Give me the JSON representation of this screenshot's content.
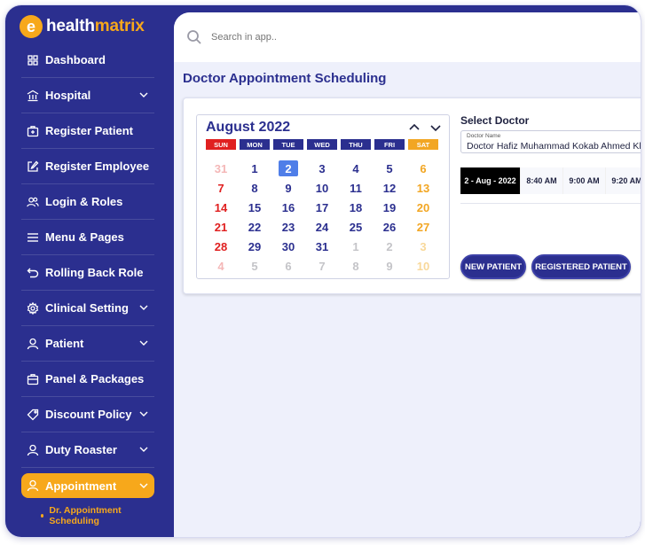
{
  "app": {
    "logo_letter": "e",
    "name_part1": "health",
    "name_part2": "matrix"
  },
  "colors": {
    "brand": "#2b2f8f",
    "accent": "#f7a81b",
    "selected_day": "#4f7ee8",
    "sunday": "#e02020",
    "saturday": "#f2a623"
  },
  "search": {
    "placeholder": "Search in app.."
  },
  "sidebar": {
    "items": [
      {
        "label": "Dashboard",
        "icon": "grid-icon",
        "expandable": false
      },
      {
        "label": "Hospital",
        "icon": "hospital-icon",
        "expandable": true
      },
      {
        "label": "Register Patient",
        "icon": "medical-bag-icon",
        "expandable": false
      },
      {
        "label": "Register Employee",
        "icon": "edit-icon",
        "expandable": false
      },
      {
        "label": "Login & Roles",
        "icon": "users-icon",
        "expandable": false
      },
      {
        "label": "Menu & Pages",
        "icon": "menu-icon",
        "expandable": false
      },
      {
        "label": "Rolling Back Role",
        "icon": "undo-icon",
        "expandable": false
      },
      {
        "label": "Clinical Setting",
        "icon": "gear-icon",
        "expandable": true
      },
      {
        "label": "Patient",
        "icon": "user-icon",
        "expandable": true
      },
      {
        "label": "Panel & Packages",
        "icon": "package-icon",
        "expandable": false
      },
      {
        "label": "Discount Policy",
        "icon": "tag-icon",
        "expandable": true
      },
      {
        "label": "Duty Roaster",
        "icon": "user-icon",
        "expandable": true
      },
      {
        "label": "Appointment",
        "icon": "user-icon",
        "expandable": true,
        "active": true
      }
    ],
    "subitem": "Dr. Appointment Scheduling"
  },
  "page": {
    "title": "Doctor Appointment Scheduling"
  },
  "calendar": {
    "month_label": "August 2022",
    "weekdays": [
      "SUN",
      "MON",
      "TUE",
      "WED",
      "THU",
      "FRI",
      "SAT"
    ],
    "weeks": [
      [
        "31",
        "1",
        "2",
        "3",
        "4",
        "5",
        "6"
      ],
      [
        "7",
        "8",
        "9",
        "10",
        "11",
        "12",
        "13"
      ],
      [
        "14",
        "15",
        "16",
        "17",
        "18",
        "19",
        "20"
      ],
      [
        "21",
        "22",
        "23",
        "24",
        "25",
        "26",
        "27"
      ],
      [
        "28",
        "29",
        "30",
        "31",
        "1",
        "2",
        "3"
      ],
      [
        "4",
        "5",
        "6",
        "7",
        "8",
        "9",
        "10"
      ]
    ],
    "selected": "2"
  },
  "doctor": {
    "section_label": "Select Doctor",
    "field_label": "Doctor Name",
    "field_value": "Doctor Hafiz Muhammad Kokab Ahmed Khan"
  },
  "slots": {
    "date": "2 - Aug - 2022",
    "times": [
      "8:40 AM",
      "9:00 AM",
      "9:20 AM"
    ]
  },
  "buttons": {
    "new_patient": "NEW PATIENT",
    "registered_patient": "REGISTERED PATIENT"
  }
}
